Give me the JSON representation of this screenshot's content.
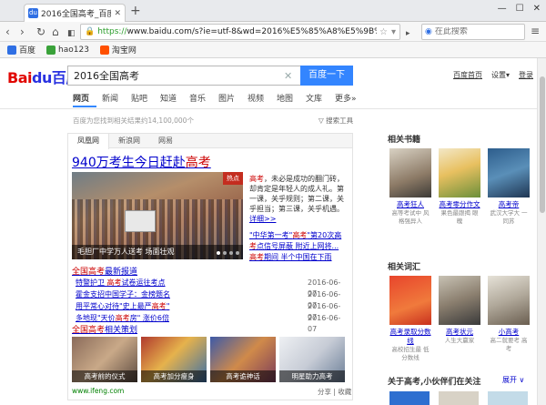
{
  "browser": {
    "tab_title": "2016全国高考_百度搜索",
    "tab_favicon": "du",
    "url_scheme": "https://",
    "url_rest": "www.baidu.com/s?ie=utf-8&wd=2016%E5%85%A8%E5%9B%BD%E9%AB%98%E",
    "search_placeholder": "在此搜索",
    "bookmarks": [
      {
        "label": "百度",
        "color": "#2f6fe4"
      },
      {
        "label": "hao123",
        "color": "#3aa23a"
      },
      {
        "label": "淘宝网",
        "color": "#ff5000"
      }
    ]
  },
  "baidu": {
    "logo_part1": "Bai",
    "logo_paw": "du",
    "logo_part2": "百度",
    "query": "2016全国高考",
    "search_button": "百度一下",
    "top_links": [
      "百度首页",
      "设置▾",
      "登录"
    ],
    "tabs": [
      "网页",
      "新闻",
      "贴吧",
      "知道",
      "音乐",
      "图片",
      "视频",
      "地图",
      "文库",
      "更多»"
    ],
    "result_count": "百度为您找到相关结果约14,100,000个",
    "search_tools": "搜索工具"
  },
  "card": {
    "tabs": [
      "凤凰网",
      "新浪网",
      "网易"
    ],
    "title_pre": "940万考生今日赶赴",
    "title_hl": "高考",
    "hero_badge": "热点",
    "hero_caption": "毛胆厂中学万人送考 场面壮观",
    "summary_hl": "高考",
    "summary_text": "，未必是成功的翻门砖，却肯定是年轻人的成人礼。第一课，关乎规则；第二课，关乎担当；第三课，关乎机遇。",
    "summary_more": "详细>>",
    "link1_pre": "\"中华第一考\"",
    "link1_hl": "高考",
    "link1_post": "\"第20次高",
    "link2_hl": "考",
    "link2_post": "点信号屏蔽 附近上网将...",
    "link3_hl": "高考",
    "link3_post": "期间 半个中国在下雨",
    "sec1_hl": "全国高考",
    "sec1_post": "最新报道",
    "news": [
      {
        "pre": "特警护卫 ",
        "hl": "高考",
        "post": "试卷运往考点",
        "date": "2016-06-07"
      },
      {
        "pre": "霍金支招中国学子：",
        "hl": "",
        "post": "金榜题名",
        "date": "2016-06-07"
      },
      {
        "pre": "用平常心对待\"史上最严",
        "hl": "高考",
        "post": "\"",
        "date": "2016-06-07"
      },
      {
        "pre": "多地现\"天价",
        "hl": "高考",
        "post": "房\" 涨价6倍",
        "date": "2016-06-07"
      }
    ],
    "sec2_hl": "全国高考",
    "sec2_post": "相关策划",
    "thumbs": [
      "高考前的仪式",
      "高考加分瘦身",
      "高考诡神话",
      "明星助力高考"
    ],
    "footer_source": "www.ifeng.com",
    "footer_actions": "分享 | 收藏"
  },
  "right": {
    "books_heading": "相关书籍",
    "books": [
      {
        "title": "高考狂人",
        "sub": "高等考试中 风格强异人"
      },
      {
        "title": "高考零分作文",
        "sub": "果色最跟揭 眼魄"
      },
      {
        "title": "高考帝",
        "sub": "武汉大学大 一同苏"
      }
    ],
    "words_heading": "相关词汇",
    "words": [
      {
        "title": "高考录取分数线",
        "sub": "高校招生最 低分数线"
      },
      {
        "title": "高考状元",
        "sub": "人生大赢家"
      },
      {
        "title": "小高考",
        "sub": "高二就要考 高考"
      }
    ],
    "bottom_heading": "关于高考,小伙伴们在关注",
    "expand": "展开 ∨"
  }
}
